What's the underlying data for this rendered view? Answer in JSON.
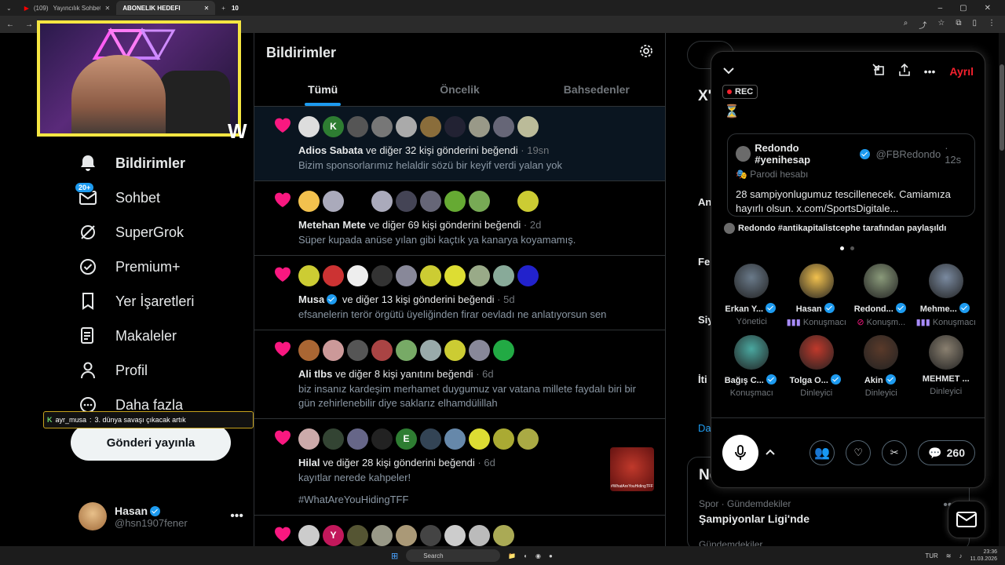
{
  "browser": {
    "tabs": [
      {
        "label": "(109)",
        "active": false
      },
      {
        "label": "Yayıncılık Sohbeti...nan - YouTube",
        "active": false
      },
      {
        "label": "ABONELIK HEDEFI",
        "active": true
      },
      {
        "label": "10",
        "active": false
      }
    ]
  },
  "overlay": {
    "chat_user": "ayr_musa",
    "chat_message": "3. dünya savaşı çıkacak artık"
  },
  "nav": {
    "items": [
      {
        "label": "Bildirimler",
        "icon": "bell-icon",
        "bold": true
      },
      {
        "label": "Sohbet",
        "icon": "mail-icon",
        "badge": "20+"
      },
      {
        "label": "SuperGrok",
        "icon": "grok-icon"
      },
      {
        "label": "Premium+",
        "icon": "premium-icon"
      },
      {
        "label": "Yer İşaretleri",
        "icon": "bookmark-icon"
      },
      {
        "label": "Makaleler",
        "icon": "article-icon"
      },
      {
        "label": "Profil",
        "icon": "person-icon"
      },
      {
        "label": "Daha fazla",
        "icon": "more-circle-icon"
      }
    ],
    "post_button": "Gönderi yayınla"
  },
  "account": {
    "name": "Hasan",
    "handle": "@hsn1907fener"
  },
  "main": {
    "title": "Bildirimler",
    "tabs": [
      "Tümü",
      "Öncelik",
      "Bahsedenler"
    ],
    "notifications": [
      {
        "who": "Adios Sabata",
        "verified": false,
        "rest": " ve diğer 32 kişi gönderini beğendi",
        "time": " · 19sn",
        "text": "Bizim sponsorlarımız helaldir sözü bir keyif verdi yalan yok",
        "avatars": [
          "#ddd",
          "#2e7d32|K",
          "#555",
          "#777",
          "#aaa",
          "#8a6d3b",
          "#223",
          "#998",
          "#667",
          "#bb9"
        ],
        "highlight": true
      },
      {
        "who": "Metehan Mete",
        "verified": false,
        "rest": " ve diğer 69 kişi gönderini beğendi",
        "time": " · 2d",
        "text": "Süper kupada anüse yılan gibi kaçtık ya kanarya koyamamış.",
        "avatars": [
          "#f2c14e",
          "#aab",
          "gap",
          "#aab",
          "#445",
          "#667",
          "#6a3",
          "#7a5",
          "gap",
          "#cc3"
        ]
      },
      {
        "who": "Musa",
        "verified": true,
        "rest": " ve diğer 13 kişi gönderini beğendi",
        "time": " · 5d",
        "text": "efsanelerin terör örgütü üyeliğinden firar oevladı ne anlatıyorsun sen",
        "avatars": [
          "#cc3",
          "#c33",
          "#eee",
          "#333",
          "#889",
          "#cc3",
          "#dd3",
          "#9a8",
          "#8a9",
          "#22c"
        ]
      },
      {
        "who": "Ali tlbs",
        "verified": false,
        "rest": " ve diğer 8 kişi yanıtını beğendi",
        "time": " · 6d",
        "text": "biz insanız kardeşim merhamet duygumuz var vatana millete faydalı biri bir gün zehirlenebilir diye saklarız elhamdülillah",
        "avatars": [
          "#a63",
          "#c99",
          "#555",
          "#a44",
          "#7a6",
          "#9aa",
          "#cc3",
          "#889",
          "#2a4"
        ]
      },
      {
        "who": "Hilal",
        "verified": false,
        "rest": " ve diğer 28 kişi gönderini beğendi",
        "time": " · 6d",
        "text": "kayıtlar nerede kahpeler!",
        "text2": "#WhatAreYouHidingTFF",
        "avatars": [
          "#caa",
          "#343",
          "#668",
          "#222",
          "#2e7d32|E",
          "#345",
          "#68a",
          "#dd3",
          "#aa3",
          "#aa4"
        ],
        "thumb": "#WhatAreYouHidingTFF"
      },
      {
        "who": "",
        "verified": false,
        "rest": "",
        "time": "",
        "text": "",
        "avatars": [
          "#ccc",
          "#c2185b|Y",
          "#553",
          "#998",
          "#a97",
          "#444",
          "#ccc",
          "#bbb",
          "#aa5"
        ]
      }
    ]
  },
  "right": {
    "trends_title": "Ne",
    "trend_category": "Spor · Gündemdekiler",
    "trend_title": "Şampiyonlar Ligi'nde",
    "next_category": "Gündemdekiler",
    "frag_1": "X'",
    "frag_2": "An",
    "frag_3": "Fe",
    "frag_4": "Siy",
    "frag_5": "İti",
    "frag_6": "Da"
  },
  "space": {
    "leave_label": "Ayrıl",
    "rec_label": "REC",
    "hourglass": "⏳",
    "quote": {
      "name": "Redondo #yenihesap",
      "handle": "@FBRedondo",
      "time": "· 12s",
      "parody": "Parodi hesabı",
      "body": "28 sampiyonlugumuz tescillenecek. Camiamıza hayırlı olsun. x.com/SportsDigitale..."
    },
    "shared_by": "Redondo #antikapitalistcephe tarafından paylaşıldı",
    "members": [
      {
        "name": "Erkan Y...",
        "role": "Yönetici",
        "verified": true,
        "color": "#6a7a8a"
      },
      {
        "name": "Hasan",
        "role": "Konuşmacı",
        "verified": true,
        "color": "#f2c14e",
        "icon": "speaking"
      },
      {
        "name": "Redond...",
        "role": "Konuşm...",
        "verified": true,
        "color": "#8a9a7a",
        "icon": "muted"
      },
      {
        "name": "Mehme...",
        "role": "Konuşmacı",
        "verified": true,
        "color": "#7a8aa0",
        "icon": "speaking"
      },
      {
        "name": "Bağış C...",
        "role": "Konuşmacı",
        "verified": true,
        "color": "#4aa8a0"
      },
      {
        "name": "Tolga O...",
        "role": "Dinleyici",
        "verified": true,
        "color": "#c0392b"
      },
      {
        "name": "Akin",
        "role": "Dinleyici",
        "verified": true,
        "color": "#5a3a2a"
      },
      {
        "name": "MEHMET ...",
        "role": "Dinleyici",
        "verified": false,
        "color": "#8a8070"
      }
    ],
    "comment_count": "260"
  },
  "taskbar": {
    "search": "Search",
    "lang": "TUR",
    "time": "23:36",
    "date": "11.03.2026"
  }
}
